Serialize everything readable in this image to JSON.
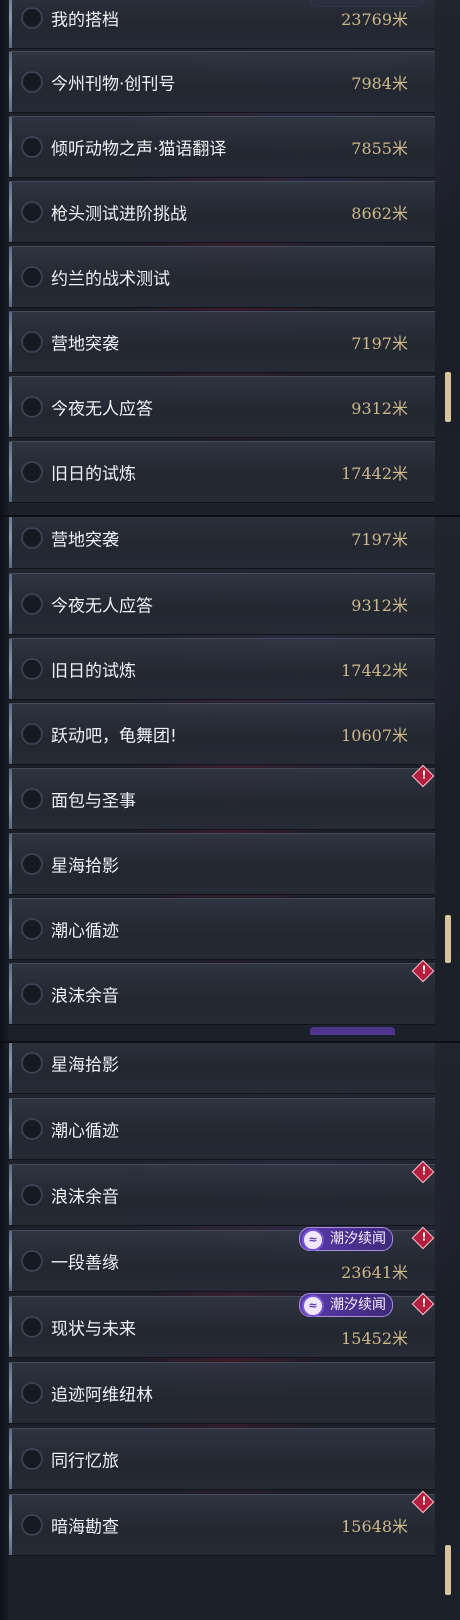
{
  "panels": [
    {
      "items": [
        {
          "label": "我的搭档",
          "distance": "23769米"
        },
        {
          "label": "今州刊物·创刊号",
          "distance": "7984米"
        },
        {
          "label": "倾听动物之声·猫语翻译",
          "distance": "7855米"
        },
        {
          "label": "枪头测试进阶挑战",
          "distance": "8662米"
        },
        {
          "label": "约兰的战术测试",
          "distance": ""
        },
        {
          "label": "营地突袭",
          "distance": "7197米"
        },
        {
          "label": "今夜无人应答",
          "distance": "9312米"
        },
        {
          "label": "旧日的试炼",
          "distance": "17442米"
        }
      ]
    },
    {
      "items": [
        {
          "label": "营地突袭",
          "distance": "7197米"
        },
        {
          "label": "今夜无人应答",
          "distance": "9312米"
        },
        {
          "label": "旧日的试炼",
          "distance": "17442米"
        },
        {
          "label": "跃动吧，龟舞团!",
          "distance": "10607米"
        },
        {
          "label": "面包与圣事",
          "distance": "",
          "alert": true
        },
        {
          "label": "星海拾影",
          "distance": ""
        },
        {
          "label": "潮心循迹",
          "distance": ""
        },
        {
          "label": "浪沫余音",
          "distance": "",
          "alert": true
        }
      ]
    },
    {
      "items": [
        {
          "label": "星海拾影",
          "distance": ""
        },
        {
          "label": "潮心循迹",
          "distance": ""
        },
        {
          "label": "浪沫余音",
          "distance": "",
          "alert": true
        },
        {
          "label": "一段善缘",
          "distance": "23641米",
          "alert": true,
          "badge": "潮汐续闻"
        },
        {
          "label": "现状与未来",
          "distance": "15452米",
          "alert": true,
          "badge": "潮汐续闻"
        },
        {
          "label": "追迹阿维纽林",
          "distance": ""
        },
        {
          "label": "同行忆旅",
          "distance": ""
        },
        {
          "label": "暗海勘查",
          "distance": "15648米",
          "alert": true
        }
      ]
    }
  ],
  "alert_symbol": "!",
  "icons": {
    "radio": "radio-circle-icon",
    "alert": "alert-diamond-icon",
    "badge": "tide-badge-icon"
  },
  "colors": {
    "distance": "#cdb88a",
    "badge": "#5b3aa8",
    "alert": "#b51e3c",
    "scrollbar": "#d8c79c"
  }
}
